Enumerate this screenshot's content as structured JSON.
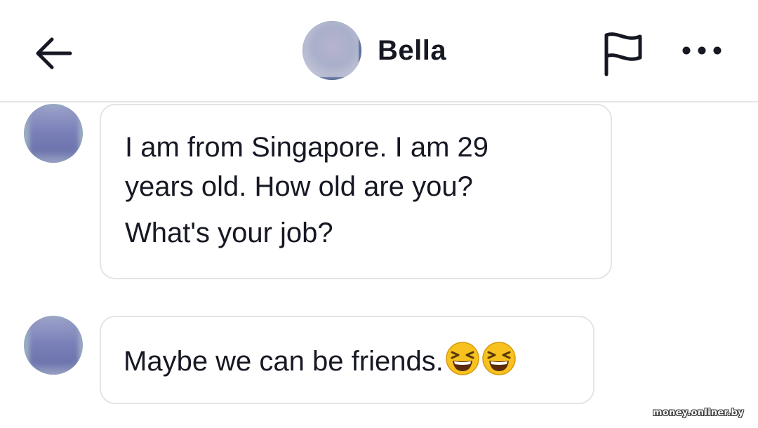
{
  "header": {
    "title": "Bella",
    "back_icon": "arrow-left-icon",
    "report_icon": "flag-icon",
    "more_icon": "more-horizontal-icon"
  },
  "messages": [
    {
      "sender": "Bella",
      "lines": [
        "I am from Singapore. I am 29",
        "years old. How old are you?",
        "What's your job?"
      ]
    },
    {
      "sender": "Bella",
      "text": "Maybe we can be friends.",
      "emojis": [
        "grinning-squinting-face-emoji",
        "grinning-squinting-face-emoji"
      ]
    }
  ],
  "watermark": "money.onliner.by",
  "colors": {
    "text": "#161823",
    "bubble_border": "#e4e4e6",
    "divider": "#e6e6e8",
    "emoji_yellow": "#f7c21f"
  }
}
